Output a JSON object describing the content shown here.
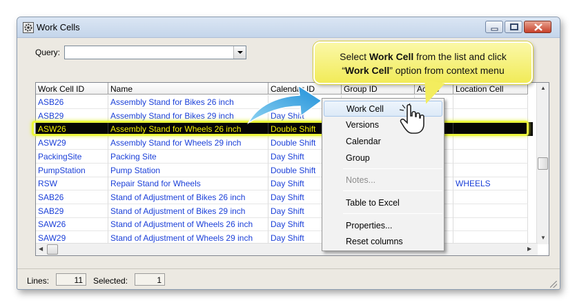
{
  "window": {
    "title": "Work Cells"
  },
  "query": {
    "label": "Query:",
    "value": ""
  },
  "columns": [
    "Work Cell ID",
    "Name",
    "Calendar ID",
    "Group ID",
    "Active",
    "Location Cell"
  ],
  "rows": [
    {
      "id": "ASB26",
      "name": "Assembly Stand for Bikes 26 inch",
      "calendar": "",
      "extra": ""
    },
    {
      "id": "ASB29",
      "name": "Assembly Stand for Bikes 29 inch",
      "calendar": "Day Shift",
      "extra": ""
    },
    {
      "id": "ASW26",
      "name": "Assembly Stand for Wheels 26 inch",
      "calendar": "Double Shift",
      "extra": ""
    },
    {
      "id": "ASW29",
      "name": "Assembly Stand for Wheels 29 inch",
      "calendar": "Double Shift",
      "extra": ""
    },
    {
      "id": "PackingSite",
      "name": "Packing Site",
      "calendar": "Day Shift",
      "extra": ""
    },
    {
      "id": "PumpStation",
      "name": "Pump Station",
      "calendar": "Double Shift",
      "extra": ""
    },
    {
      "id": "RSW",
      "name": "Repair Stand for Wheels",
      "calendar": "Day Shift",
      "extra": "WHEELS"
    },
    {
      "id": "SAB26",
      "name": "Stand of Adjustment of Bikes 26 inch",
      "calendar": "Day Shift",
      "extra": ""
    },
    {
      "id": "SAB29",
      "name": "Stand of Adjustment of Bikes 29 inch",
      "calendar": "Day Shift",
      "extra": ""
    },
    {
      "id": "SAW26",
      "name": "Stand of Adjustment of Wheels 26 inch",
      "calendar": "Day Shift",
      "extra": ""
    },
    {
      "id": "SAW29",
      "name": "Stand of Adjustment of Wheels 29 inch",
      "calendar": "Day Shift",
      "extra": ""
    }
  ],
  "selected_row": 2,
  "context_menu": {
    "items": [
      "Work Cell",
      "Versions",
      "Calendar",
      "Group",
      "Notes...",
      "Table to Excel",
      "Properties...",
      "Reset columns"
    ],
    "hovered": "Work Cell",
    "disabled": [
      "Notes..."
    ]
  },
  "callout": {
    "line1_pre": "Select ",
    "line1_bold": "Work Cell",
    "line1_post": " from the list and click",
    "line2_pre": "“",
    "line2_bold": "Work Cell",
    "line2_post": "” option from context menu"
  },
  "status": {
    "lines_label": "Lines:",
    "lines_value": "11",
    "selected_label": "Selected:",
    "selected_value": "1"
  },
  "colors": {
    "link_text": "#1a3fd8",
    "selection_bg": "#050505",
    "selection_text": "#f6f200",
    "callout_bg": "#f1eb58"
  },
  "icons": {
    "app": "work-cells-gear-icon",
    "pointer": "hand-pointer-icon"
  }
}
